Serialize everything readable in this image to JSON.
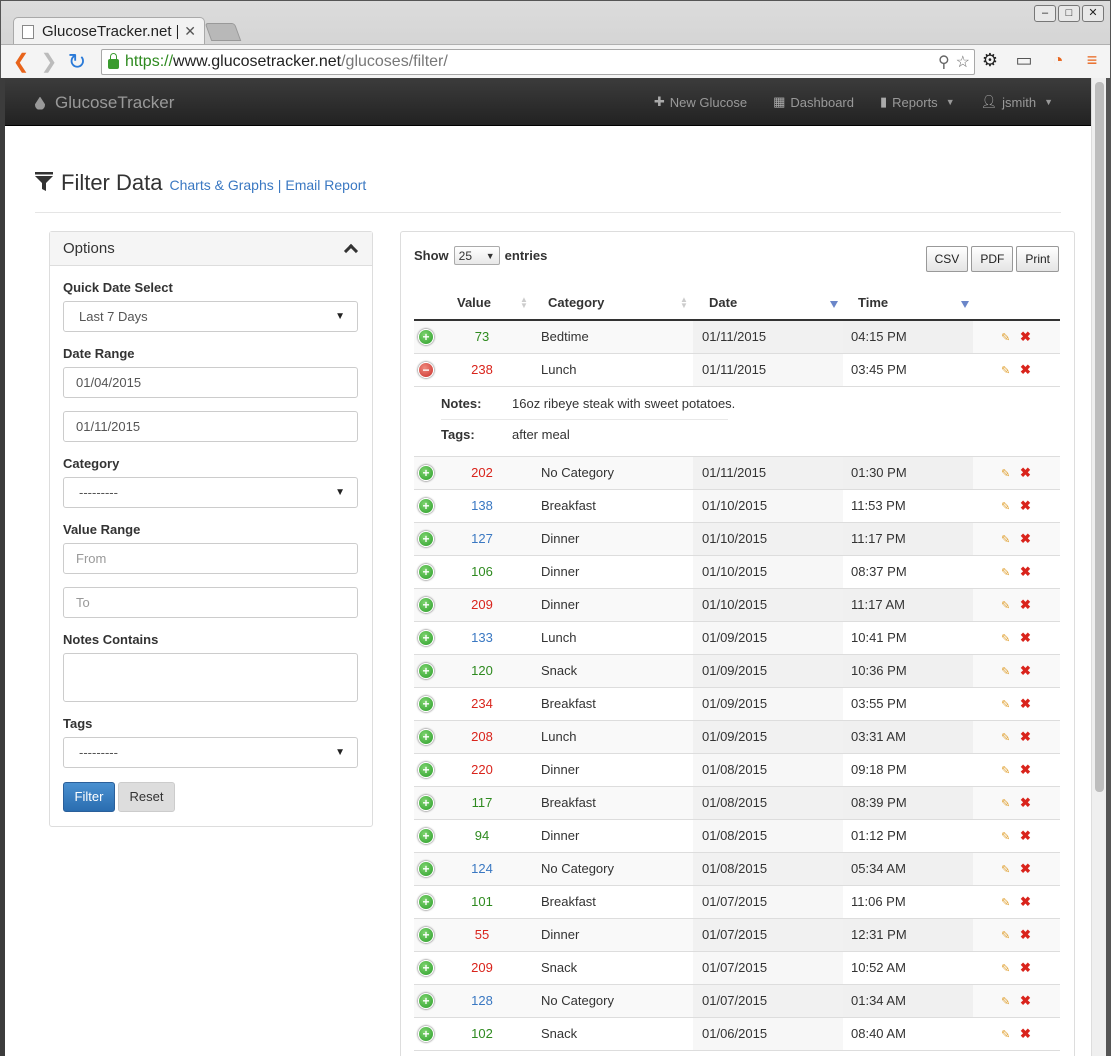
{
  "browser": {
    "tab_title": "GlucoseTracker.net |",
    "url_scheme": "https://",
    "url_host": "www.glucosetracker.net",
    "url_path": "/glucoses/filter/"
  },
  "navbar": {
    "brand": "GlucoseTracker",
    "links": {
      "new_glucose": "New Glucose",
      "dashboard": "Dashboard",
      "reports": "Reports",
      "user": "jsmith"
    }
  },
  "header": {
    "title": "Filter Data",
    "charts_link": "Charts & Graphs",
    "separator": "|",
    "email_link": "Email Report"
  },
  "options": {
    "title": "Options",
    "quick_date_label": "Quick Date Select",
    "quick_date_value": "Last 7 Days",
    "date_range_label": "Date Range",
    "date_from": "01/04/2015",
    "date_to": "01/11/2015",
    "category_label": "Category",
    "category_value": "---------",
    "value_range_label": "Value Range",
    "value_from_placeholder": "From",
    "value_to_placeholder": "To",
    "notes_label": "Notes Contains",
    "tags_label": "Tags",
    "tags_value": "---------",
    "filter_button": "Filter",
    "reset_button": "Reset"
  },
  "table": {
    "show_label": "Show",
    "entries_count": "25",
    "entries_label": "entries",
    "export_buttons": {
      "csv": "CSV",
      "pdf": "PDF",
      "print": "Print"
    },
    "columns": {
      "value": "Value",
      "category": "Category",
      "date": "Date",
      "time": "Time"
    },
    "rows": [
      {
        "value": "73",
        "color": "green",
        "category": "Bedtime",
        "date": "01/11/2015",
        "time": "04:15 PM"
      },
      {
        "value": "238",
        "color": "red",
        "category": "Lunch",
        "date": "01/11/2015",
        "time": "03:45 PM",
        "expanded": true
      },
      {
        "value": "202",
        "color": "red",
        "category": "No Category",
        "date": "01/11/2015",
        "time": "01:30 PM"
      },
      {
        "value": "138",
        "color": "blue",
        "category": "Breakfast",
        "date": "01/10/2015",
        "time": "11:53 PM"
      },
      {
        "value": "127",
        "color": "blue",
        "category": "Dinner",
        "date": "01/10/2015",
        "time": "11:17 PM"
      },
      {
        "value": "106",
        "color": "green",
        "category": "Dinner",
        "date": "01/10/2015",
        "time": "08:37 PM"
      },
      {
        "value": "209",
        "color": "red",
        "category": "Dinner",
        "date": "01/10/2015",
        "time": "11:17 AM"
      },
      {
        "value": "133",
        "color": "blue",
        "category": "Lunch",
        "date": "01/09/2015",
        "time": "10:41 PM"
      },
      {
        "value": "120",
        "color": "green",
        "category": "Snack",
        "date": "01/09/2015",
        "time": "10:36 PM"
      },
      {
        "value": "234",
        "color": "red",
        "category": "Breakfast",
        "date": "01/09/2015",
        "time": "03:55 PM"
      },
      {
        "value": "208",
        "color": "red",
        "category": "Lunch",
        "date": "01/09/2015",
        "time": "03:31 AM"
      },
      {
        "value": "220",
        "color": "red",
        "category": "Dinner",
        "date": "01/08/2015",
        "time": "09:18 PM"
      },
      {
        "value": "117",
        "color": "green",
        "category": "Breakfast",
        "date": "01/08/2015",
        "time": "08:39 PM"
      },
      {
        "value": "94",
        "color": "green",
        "category": "Dinner",
        "date": "01/08/2015",
        "time": "01:12 PM"
      },
      {
        "value": "124",
        "color": "blue",
        "category": "No Category",
        "date": "01/08/2015",
        "time": "05:34 AM"
      },
      {
        "value": "101",
        "color": "green",
        "category": "Breakfast",
        "date": "01/07/2015",
        "time": "11:06 PM"
      },
      {
        "value": "55",
        "color": "red",
        "category": "Dinner",
        "date": "01/07/2015",
        "time": "12:31 PM"
      },
      {
        "value": "209",
        "color": "red",
        "category": "Snack",
        "date": "01/07/2015",
        "time": "10:52 AM"
      },
      {
        "value": "128",
        "color": "blue",
        "category": "No Category",
        "date": "01/07/2015",
        "time": "01:34 AM"
      },
      {
        "value": "102",
        "color": "green",
        "category": "Snack",
        "date": "01/06/2015",
        "time": "08:40 AM"
      }
    ],
    "detail": {
      "notes_label": "Notes:",
      "notes_value": "16oz ribeye steak with sweet potatoes.",
      "tags_label": "Tags:",
      "tags_value": "after meal"
    }
  },
  "colors": {
    "green": "#2e8a1f",
    "red": "#d9241c",
    "blue": "#3a78c2",
    "link": "#3a78c2",
    "primary_button": "#2a6db0"
  }
}
